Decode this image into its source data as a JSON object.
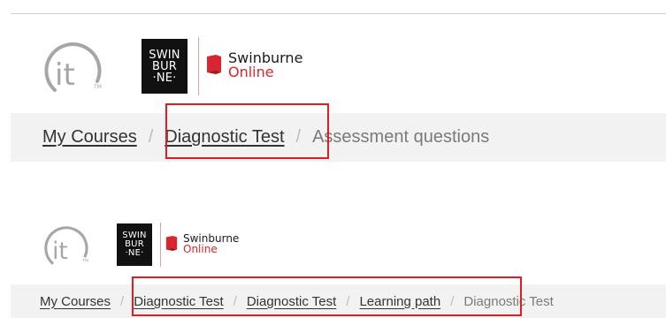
{
  "top_block": {
    "it_logo": {
      "text": "it",
      "icon": "it-logo-icon"
    },
    "swinburne_logo": {
      "lines": [
        "SWIN",
        "BUR",
        "·NE·"
      ],
      "icon": "swinburne-logo-icon"
    },
    "brand": {
      "line1": "Swinburne",
      "line2": "Online",
      "icon": "red-book-icon"
    },
    "breadcrumb": {
      "items": [
        "My Courses",
        "Diagnostic Test"
      ],
      "separator": "/",
      "current": "Assessment questions"
    },
    "highlight_color": "#e31b23"
  },
  "bottom_block": {
    "it_logo": {
      "text": "it",
      "icon": "it-logo-icon"
    },
    "swinburne_logo": {
      "lines": [
        "SWIN",
        "BUR",
        "·NE·"
      ],
      "icon": "swinburne-logo-icon"
    },
    "brand": {
      "line1": "Swinburne",
      "line2": "Online",
      "icon": "red-book-icon"
    },
    "breadcrumb": {
      "items": [
        "My Courses",
        "Diagnostic Test",
        "Diagnostic Test",
        "Learning path"
      ],
      "separator": "/",
      "current": "Diagnostic Test"
    },
    "highlight_color": "#e31b23"
  },
  "colors": {
    "brand_red": "#d7262f",
    "breadcrumb_bg": "#f2f2f2",
    "highlight": "#e31b23"
  }
}
